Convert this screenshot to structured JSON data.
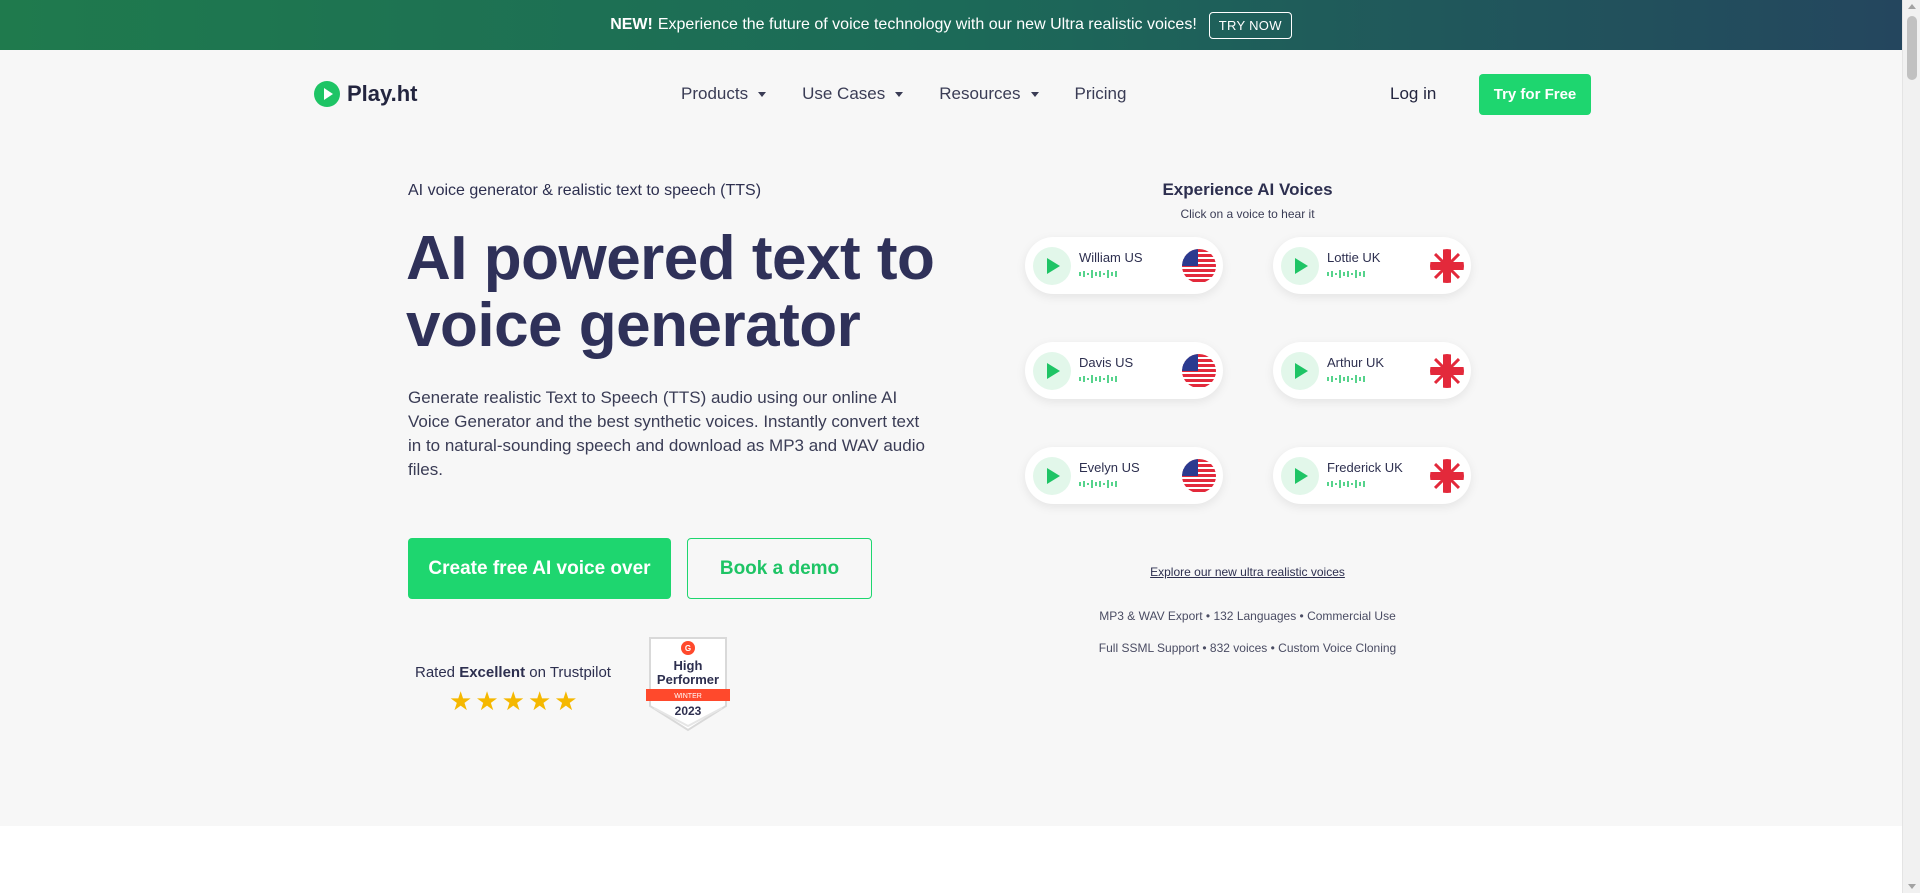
{
  "banner": {
    "new_label": "NEW!",
    "text": "Experience the future of voice technology with our new Ultra realistic voices!",
    "cta": "TRY NOW"
  },
  "nav": {
    "logo_text": "Play.ht",
    "menu": [
      {
        "label": "Products",
        "dropdown": true
      },
      {
        "label": "Use Cases",
        "dropdown": true
      },
      {
        "label": "Resources",
        "dropdown": true
      },
      {
        "label": "Pricing",
        "dropdown": false
      }
    ],
    "login": "Log in",
    "try_free": "Try for Free"
  },
  "hero": {
    "eyebrow": "AI voice generator & realistic text to speech (TTS)",
    "headline": "AI powered text to voice generator",
    "description": "Generate realistic Text to Speech (TTS) audio using our online AI Voice Generator and the best synthetic voices. Instantly convert text in to natural-sounding speech and download as MP3 and WAV audio files.",
    "primary_cta": "Create free AI voice over",
    "secondary_cta": "Book a demo",
    "rating": {
      "prefix": "Rated",
      "word": "Excellent",
      "suffix": "on Trustpilot",
      "stars": 5
    },
    "badge": {
      "title_1": "High",
      "title_2": "Performer",
      "season": "WINTER",
      "year": "2023"
    }
  },
  "voices": {
    "title": "Experience AI Voices",
    "subtitle": "Click on a voice to hear it",
    "items": [
      {
        "name": "William US",
        "flag": "us-flag-icon"
      },
      {
        "name": "Lottie UK",
        "flag": "uk-flag-icon"
      },
      {
        "name": "Davis US",
        "flag": "us-flag-icon"
      },
      {
        "name": "Arthur UK",
        "flag": "uk-flag-icon"
      },
      {
        "name": "Evelyn US",
        "flag": "us-flag-icon"
      },
      {
        "name": "Frederick UK",
        "flag": "uk-flag-icon"
      }
    ],
    "explore_link": "Explore our new ultra realistic voices",
    "features_line_1": "MP3 & WAV Export  •  132 Languages  •  Commercial Use",
    "features_line_2": "Full SSML Support  •  832 voices  •  Custom Voice Cloning"
  },
  "colors": {
    "brand_green": "#1ed66f",
    "heading": "#2f3159",
    "uk_red": "#e3293b",
    "us_blue": "#2b3a8f"
  }
}
